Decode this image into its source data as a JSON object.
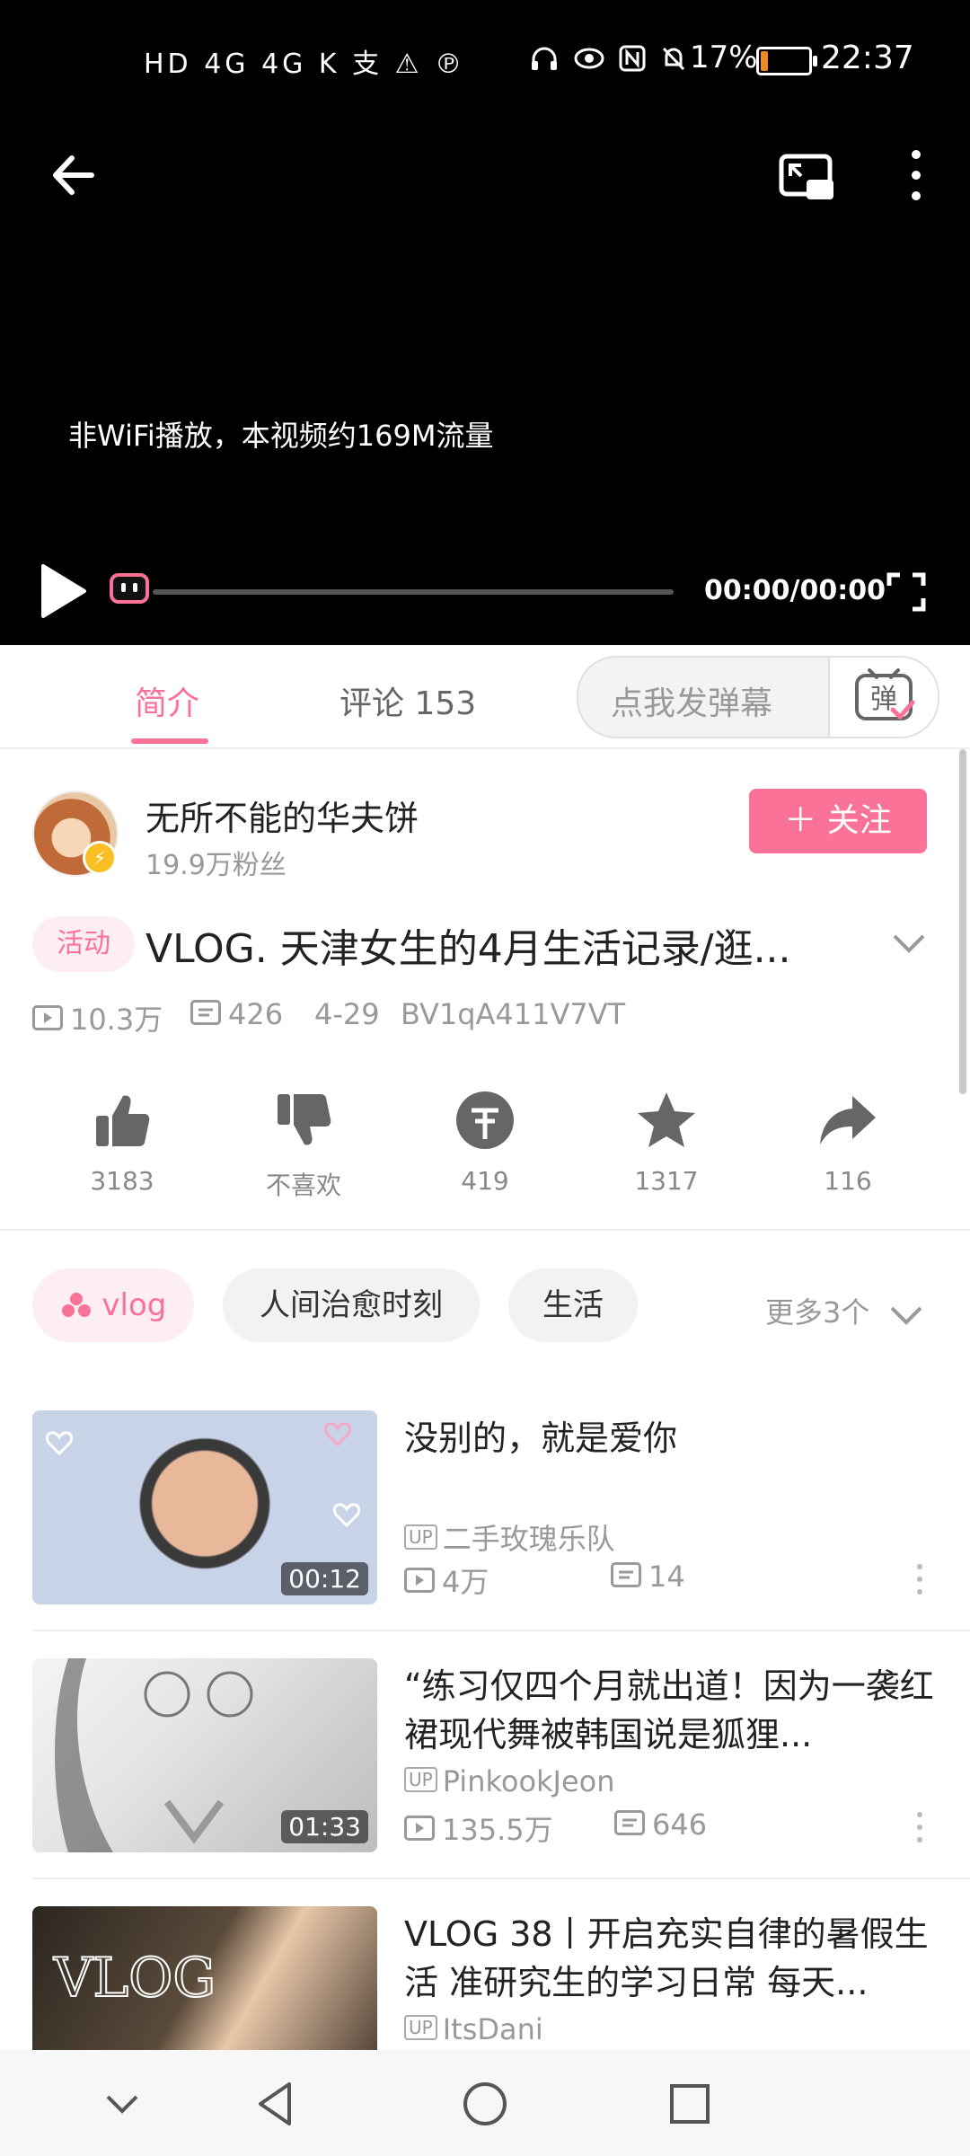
{
  "status_bar": {
    "left_icons": "HD 4G 4G K 支 ⚠ ℗",
    "battery_percent": "17%",
    "battery_level": 0.17,
    "time": "22:37"
  },
  "player": {
    "notice": "非WiFi播放，本视频约169M流量",
    "time": "00:00/00:00"
  },
  "tabs": {
    "intro": "简介",
    "comments": "评论 153",
    "danmaku_placeholder": "点我发弹幕",
    "danmaku_button": "弹"
  },
  "uploader": {
    "name": "无所不能的华夫饼",
    "fans": "19.9万粉丝",
    "follow_label": "＋ 关注"
  },
  "video": {
    "badge": "活动",
    "title": "VLOG. 天津女生的4月生活记录/逛...",
    "views": "10.3万",
    "danmaku": "426",
    "date": "4-29",
    "bvid": "BV1qA411V7VT"
  },
  "actions": {
    "like": "3183",
    "dislike": "不喜欢",
    "coin": "419",
    "favorite": "1317",
    "share": "116"
  },
  "tags": {
    "items": [
      "vlog",
      "人间治愈时刻",
      "生活"
    ],
    "more": "更多3个"
  },
  "related": [
    {
      "title": "没别的，就是爱你",
      "up": "二手玫瑰乐队",
      "duration": "00:12",
      "views": "4万",
      "danmaku": "14"
    },
    {
      "title": "“练习仅四个月就出道！因为一袭红裙现代舞被韩国说是狐狸...",
      "up": "PinkookJeon",
      "duration": "01:33",
      "views": "135.5万",
      "danmaku": "646"
    },
    {
      "title": "VLOG 38丨开启充实自律的暑假生活 准研究生的学习日常 每天...",
      "up": "ItsDani",
      "duration": "",
      "views": "",
      "danmaku": ""
    }
  ],
  "colors": {
    "accent": "#fb7299",
    "player_bg": "#000000",
    "battery": "#f08a1c"
  }
}
